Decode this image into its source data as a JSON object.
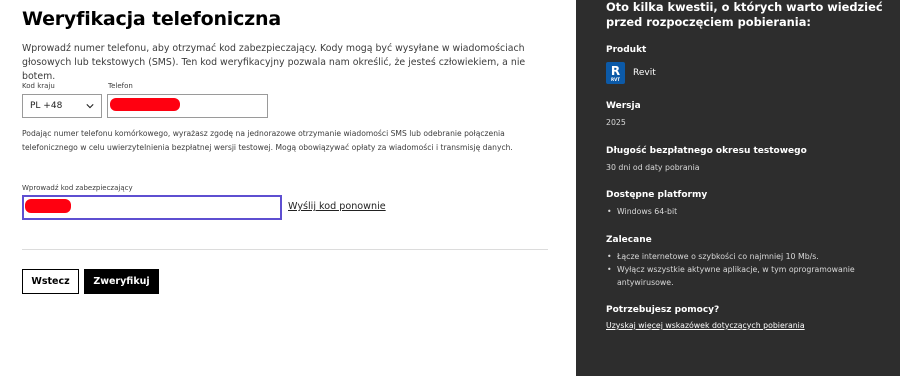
{
  "form": {
    "title": "Weryfikacja telefoniczna",
    "intro": "Wprowadź numer telefonu, aby otrzymać kod zabezpieczający. Kody mogą być wysyłane w wiadomościach głosowych lub tekstowych (SMS). Ten kod weryfikacyjny pozwala nam określić, że jesteś człowiekiem, a nie botem.",
    "country_label": "Kod kraju",
    "country_value": "PL +48",
    "phone_label": "Telefon",
    "consent": "Podając numer telefonu komórkowego, wyrażasz zgodę na jednorazowe otrzymanie wiadomości SMS lub odebranie połączenia telefonicznego w celu uwierzytelnienia bezpłatnej wersji testowej. Mogą obowiązywać opłaty za wiadomości i transmisję danych.",
    "code_label": "Wprowadź kod zabezpieczający",
    "resend_label": "Wyślij kod ponownie",
    "back_label": "Wstecz",
    "verify_label": "Zweryfikuj"
  },
  "sidebar": {
    "header": "Oto kilka kwestii, o których warto wiedzieć przed rozpoczęciem pobierania:",
    "product_title": "Produkt",
    "product_name": "Revit",
    "logo_letter": "R",
    "logo_sub": "RVT",
    "version_title": "Wersja",
    "version_value": "2025",
    "trial_title": "Długość bezpłatnego okresu testowego",
    "trial_value": "30 dni od daty pobrania",
    "platforms_title": "Dostępne platformy",
    "platforms": [
      "Windows 64-bit"
    ],
    "recommend_title": "Zalecane",
    "recommendations": [
      "Łącze internetowe o szybkości co najmniej 10 Mb/s.",
      "Wyłącz wszystkie aktywne aplikacje, w tym oprogramowanie antywirusowe."
    ],
    "help_title": "Potrzebujesz pomocy?",
    "help_link": "Uzyskaj więcej wskazówek dotyczących pobierania"
  },
  "colors": {
    "accent": "#5e4fd1",
    "sidebar_bg": "#2d2d2d",
    "redaction": "#ff0010",
    "revit_blue": "#0c5aa8"
  }
}
